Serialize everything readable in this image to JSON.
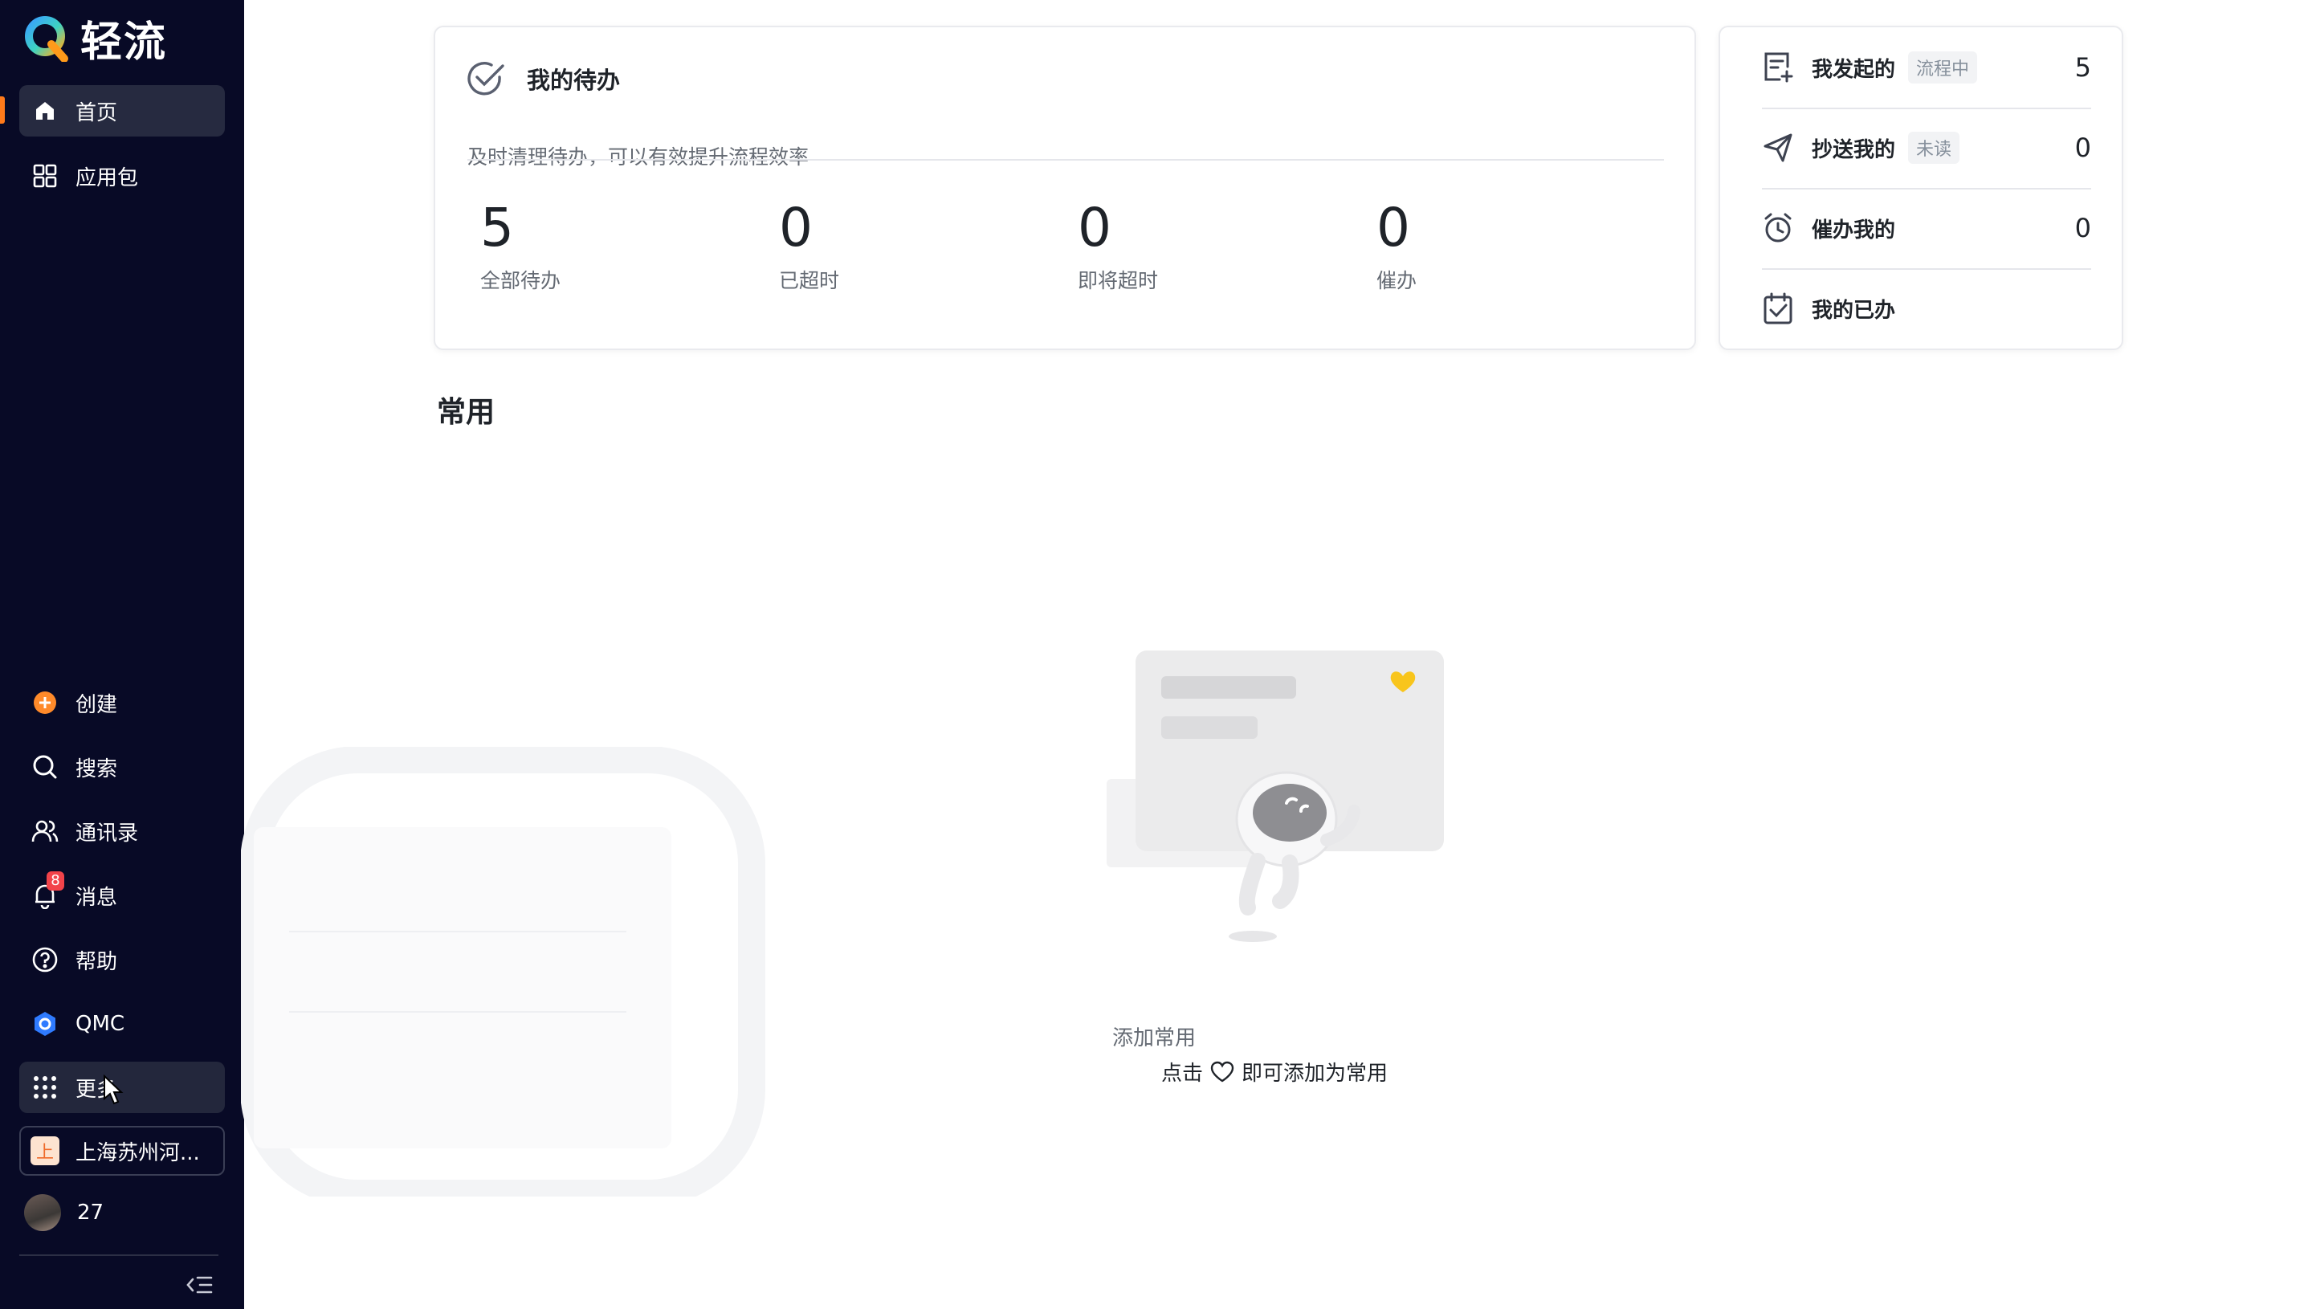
{
  "app": {
    "name": "轻流"
  },
  "sidebar": {
    "top_items": [
      {
        "label": "首页",
        "icon": "home-icon",
        "active": true
      },
      {
        "label": "应用包",
        "icon": "grid-apps-icon"
      }
    ],
    "bottom_items": [
      {
        "label": "创建",
        "icon": "plus-circle-icon"
      },
      {
        "label": "搜索",
        "icon": "search-icon"
      },
      {
        "label": "通讯录",
        "icon": "contacts-icon"
      },
      {
        "label": "消息",
        "icon": "bell-icon",
        "badge": "8"
      },
      {
        "label": "帮助",
        "icon": "help-icon"
      },
      {
        "label": "QMC",
        "icon": "qmc-hexagon-icon"
      },
      {
        "label": "更多",
        "icon": "dots-grid-icon"
      }
    ],
    "workspace": {
      "icon_char": "上",
      "label": "上海苏州河..."
    },
    "user": {
      "label": "27"
    }
  },
  "todo": {
    "title": "我的待办",
    "subtitle": "及时清理待办，可以有效提升流程效率",
    "stats": [
      {
        "value": "5",
        "label": "全部待办"
      },
      {
        "value": "0",
        "label": "已超时"
      },
      {
        "value": "0",
        "label": "即将超时"
      },
      {
        "value": "0",
        "label": "催办"
      }
    ]
  },
  "side_panel": {
    "rows": [
      {
        "label": "我发起的",
        "tag": "流程中",
        "count": "5",
        "icon": "document-add-icon"
      },
      {
        "label": "抄送我的",
        "tag": "未读",
        "count": "0",
        "icon": "send-icon"
      },
      {
        "label": "催办我的",
        "tag": "",
        "count": "0",
        "icon": "alarm-clock-icon"
      },
      {
        "label": "我的已办",
        "tag": "",
        "count": "",
        "icon": "calendar-check-icon"
      }
    ]
  },
  "common": {
    "title": "常用",
    "empty_title": "添加常用",
    "hint_before": "点击",
    "hint_after": "即可添加为常用"
  },
  "colors": {
    "sidebar_bg": "#080a26",
    "accent_orange": "#ff7a1a",
    "badge_red": "#f2434a",
    "heart_yellow": "#f8c51c"
  }
}
